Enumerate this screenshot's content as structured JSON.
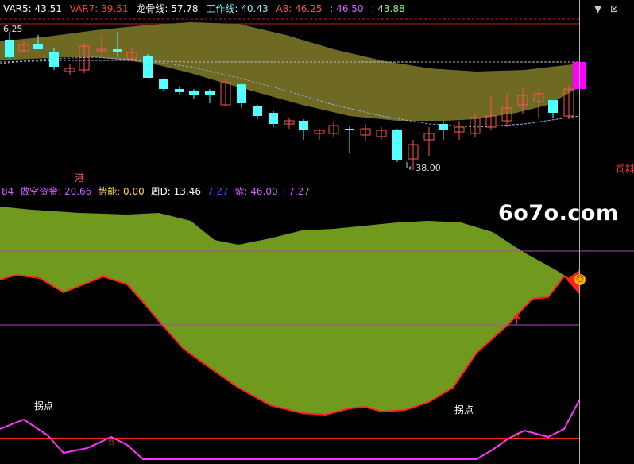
{
  "top_panel": {
    "indicators": [
      {
        "label": "VAR5: 43.51",
        "color": "#ffffff"
      },
      {
        "label": "VAR7: 39.51",
        "color": "#ff3b3b"
      },
      {
        "label": "龙骨线: 57.78",
        "color": "#ffffff"
      },
      {
        "label": "工作线: 40.43",
        "color": "#7ff7f7"
      },
      {
        "label": "A8: 46.25",
        "color": "#ff5050"
      },
      {
        "label": ": 46.50",
        "color": "#e05cff"
      },
      {
        "label": ": 43.88",
        "color": "#7ff57f"
      }
    ],
    "price_high_label": "6.25",
    "low_label": "38.00",
    "marker_left": "港",
    "side_label": "饲料"
  },
  "bottom_panel": {
    "indicators": [
      {
        "label": "84",
        "color": "#d060ff"
      },
      {
        "label": "做空资金: 20.66",
        "color": "#d060ff"
      },
      {
        "label": "势能: 0.00",
        "color": "#ffd54a"
      },
      {
        "label": "周D: 13.46",
        "color": "#ffffff"
      },
      {
        "label": "7.27",
        "color": "#4a4aff"
      },
      {
        "label": "紫: 46.00",
        "color": "#d060ff"
      },
      {
        "label": ": 7.27",
        "color": "#d060ff"
      }
    ],
    "turn_point_left": "拐点",
    "turn_point_right": "拐点"
  },
  "watermark": "6o7o.com",
  "colors": {
    "up": "#ff5454",
    "down": "#54ffff",
    "band": "#6e6a24",
    "green_fill": "#6f9a1e",
    "magenta": "#ff00ff",
    "red_line": "#ff2020"
  }
}
